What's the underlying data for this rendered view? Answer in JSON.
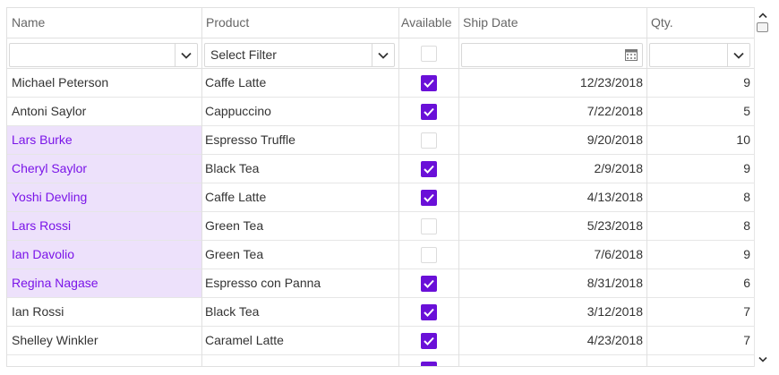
{
  "columns": {
    "name": "Name",
    "product": "Product",
    "available": "Available",
    "ship_date": "Ship Date",
    "qty": "Qty."
  },
  "filters": {
    "name_value": "",
    "product_placeholder": "Select Filter",
    "ship_date_value": "",
    "qty_value": ""
  },
  "rows": [
    {
      "name": "Michael Peterson",
      "product": "Caffe Latte",
      "available": true,
      "ship_date": "12/23/2018",
      "qty": "9",
      "selected": false
    },
    {
      "name": "Antoni Saylor",
      "product": "Cappuccino",
      "available": true,
      "ship_date": "7/22/2018",
      "qty": "5",
      "selected": false
    },
    {
      "name": "Lars Burke",
      "product": "Espresso Truffle",
      "available": false,
      "ship_date": "9/20/2018",
      "qty": "10",
      "selected": true
    },
    {
      "name": "Cheryl Saylor",
      "product": "Black Tea",
      "available": true,
      "ship_date": "2/9/2018",
      "qty": "9",
      "selected": true
    },
    {
      "name": "Yoshi Devling",
      "product": "Caffe Latte",
      "available": true,
      "ship_date": "4/13/2018",
      "qty": "8",
      "selected": true
    },
    {
      "name": "Lars Rossi",
      "product": "Green Tea",
      "available": false,
      "ship_date": "5/23/2018",
      "qty": "8",
      "selected": true
    },
    {
      "name": "Ian Davolio",
      "product": "Green Tea",
      "available": false,
      "ship_date": "7/6/2018",
      "qty": "9",
      "selected": true
    },
    {
      "name": "Regina Nagase",
      "product": "Espresso con Panna",
      "available": true,
      "ship_date": "8/31/2018",
      "qty": "6",
      "selected": true
    },
    {
      "name": "Ian Rossi",
      "product": "Black Tea",
      "available": true,
      "ship_date": "3/12/2018",
      "qty": "7",
      "selected": false
    },
    {
      "name": "Shelley Winkler",
      "product": "Caramel Latte",
      "available": true,
      "ship_date": "4/23/2018",
      "qty": "7",
      "selected": false
    },
    {
      "name": "",
      "product": "",
      "available": true,
      "ship_date": "",
      "qty": "",
      "selected": false
    }
  ],
  "icons": {
    "dropdown": "chevron-down-icon",
    "calendar": "calendar-icon",
    "scroll_up": "chevron-up-icon",
    "scroll_down": "chevron-down-icon"
  },
  "colors": {
    "accent": "#6a10d8",
    "selected_bg": "#ede1fb",
    "selected_text": "#7a14e8"
  }
}
